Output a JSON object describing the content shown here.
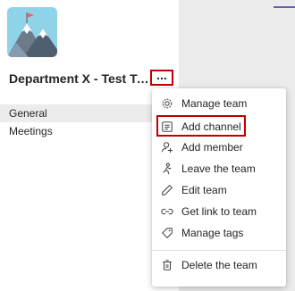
{
  "team": {
    "name": "Department X - Test Te...",
    "more_label": "..."
  },
  "channels": [
    {
      "label": "General",
      "selected": true
    },
    {
      "label": "Meetings",
      "selected": false
    }
  ],
  "menu": {
    "items": [
      {
        "label": "Manage team",
        "icon": "gear-icon"
      },
      {
        "label": "Add channel",
        "icon": "add-channel-icon",
        "highlighted": true
      },
      {
        "label": "Add member",
        "icon": "add-member-icon"
      },
      {
        "label": "Leave the team",
        "icon": "leave-icon"
      },
      {
        "label": "Edit team",
        "icon": "pencil-icon"
      },
      {
        "label": "Get link to team",
        "icon": "link-icon"
      },
      {
        "label": "Manage tags",
        "icon": "tag-icon"
      },
      {
        "label": "Delete the team",
        "icon": "trash-icon"
      }
    ]
  },
  "colors": {
    "highlight": "#c00000",
    "accent": "#6264a7"
  }
}
